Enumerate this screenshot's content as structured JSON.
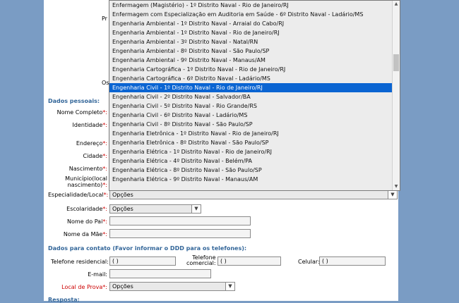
{
  "partial_labels": {
    "pr": "Pr",
    "os": "Os"
  },
  "personal": {
    "title": "Dados pessoais:",
    "nome": "Nome Completo",
    "identidade": "Identidade",
    "endereco": "Endereço",
    "cidade": "Cidade",
    "nascimento": "Nascimento",
    "municipio_1": "Município(local",
    "municipio_2": "nascimento)",
    "especialidade": "Especialidade/Local",
    "especialidade_value": "Opções",
    "escolaridade": "Escolaridade",
    "escolaridade_value": "Opções",
    "pai": "Nome do Pai",
    "mae": "Nome da Mãe",
    "star": "*:"
  },
  "contact": {
    "title": "Dados para contato (Favor informar o DDD para os telefones):",
    "tel_res": "Telefone residencial:",
    "tel_res_value": "( )",
    "tel_com_1": "Telefone",
    "tel_com_2": "comercial:",
    "tel_com_value": "( )",
    "celular": "Celular:",
    "celular_value": "( )",
    "email": "E-mail:",
    "local_prova": "Local de Prova",
    "local_prova_value": "Opções",
    "resposta": "Resposta:"
  },
  "dropdown": {
    "options": [
      "Enfermagem (Magistério) - 1º Distrito Naval - Rio de Janeiro/RJ",
      "Enfermagem com Especialização em Auditoria em Saúde - 6º Distrito Naval - Ladário/MS",
      "Engenharia Ambiental - 1º Distrito Naval - Arraial do Cabo/RJ",
      "Engenharia Ambiental - 1º Distrito Naval - Rio de Janeiro/RJ",
      "Engenharia Ambiental - 3º Distrito Naval - Natal/RN",
      "Engenharia Ambiental - 8º Distrito Naval - São Paulo/SP",
      "Engenharia Ambiental - 9º Distrito Naval - Manaus/AM",
      "Engenharia Cartográfica - 1º Distrito Naval - Rio de Janeiro/RJ",
      "Engenharia Cartográfica - 6º Distrito Naval - Ladário/MS",
      "Engenharia Civil - 1º Distrito Naval - Rio de Janeiro/RJ",
      "Engenharia Civil - 2º Distrito Naval - Salvador/BA",
      "Engenharia Civil - 5º Distrito Naval - Rio Grande/RS",
      "Engenharia Civil - 6º Distrito Naval - Ladário/MS",
      "Engenharia Civil - 8º Distrito Naval - São Paulo/SP",
      "Engenharia Eletrônica - 1º Distrito Naval - Rio de Janeiro/RJ",
      "Engenharia Eletrônica - 8º Distrito Naval - São Paulo/SP",
      "Engenharia Elétrica - 1º Distrito Naval - Rio de Janeiro/RJ",
      "Engenharia Elétrica - 4º Distrito Naval - Belém/PA",
      "Engenharia Elétrica - 8º Distrito Naval - São Paulo/SP",
      "Engenharia Elétrica - 9º Distrito Naval - Manaus/AM"
    ],
    "selected_index": 9
  },
  "icons": {
    "chevron": "chevron-down-icon",
    "scroll_up": "scroll-up-icon",
    "scroll_down": "scroll-down-icon"
  }
}
